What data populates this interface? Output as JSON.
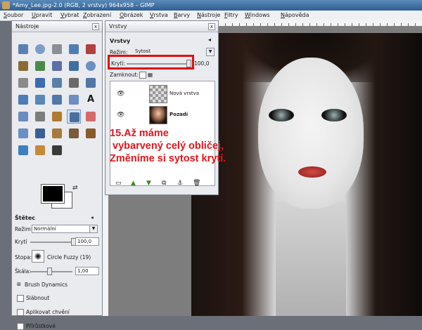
{
  "window": {
    "title": "*Amy_Lee.jpg-2.0 (RGB, 2 vrstvy) 964x958 – GIMP"
  },
  "menu": [
    {
      "label": "Soubor",
      "u": "S",
      "rest": "oubor"
    },
    {
      "label": "Upravit",
      "u": "U",
      "rest": "pravit"
    },
    {
      "label": "Vybrat",
      "u": "V",
      "rest": "ybrat"
    },
    {
      "label": "Zobrazení",
      "u": "Z",
      "rest": "obrazení"
    },
    {
      "label": "Obrázek",
      "u": "O",
      "rest": "brázek"
    },
    {
      "label": "Vrstva",
      "u": "V",
      "rest": "rstva"
    },
    {
      "label": "Barvy",
      "u": "B",
      "rest": "arvy"
    },
    {
      "label": "Nástroje",
      "u": "N",
      "rest": "ástroje"
    },
    {
      "label": "Filtry",
      "u": "F",
      "rest": "iltry"
    },
    {
      "label": "Windows",
      "u": "W",
      "rest": "indows"
    },
    {
      "label": "Nápověda",
      "u": "N",
      "rest": "ápověda"
    }
  ],
  "tools_panel": {
    "title": "Nástroje",
    "close": "x",
    "icons": [
      "rect-select-icon",
      "ellipse-select-icon",
      "free-select-icon",
      "fuzzy-select-icon",
      "color-select-icon",
      "scissors-icon",
      "foreground-select-icon",
      "paths-icon",
      "color-picker-icon",
      "zoom-icon",
      "measure-icon",
      "move-icon",
      "align-icon",
      "crop-icon",
      "rotate-icon",
      "scale-icon",
      "shear-icon",
      "perspective-icon",
      "flip-icon",
      "text-icon",
      "bucket-fill-icon",
      "blend-icon",
      "pencil-icon",
      "paintbrush-icon",
      "eraser-icon",
      "airbrush-icon",
      "ink-icon",
      "clone-icon",
      "heal-icon",
      "perspective-clone-icon",
      "blur-icon",
      "smudge-icon",
      "dodge-burn-icon"
    ]
  },
  "brush": {
    "title": "Štětec",
    "mode_label": "Režim:",
    "mode_value": "Normální",
    "opacity_label": "Krytí",
    "opacity_value": "100,0",
    "brush_label": "Stopa:",
    "brush_value": "Circle Fuzzy (19)",
    "scale_label": "Škála:",
    "scale_value": "1,00",
    "dynamics_label": "Brush Dynamics",
    "options": [
      "Slábnout",
      "Aplikovat chvění",
      "Přírůstkové"
    ]
  },
  "layers_panel": {
    "tab_title": "Vrstvy",
    "section_title": "Vrstvy",
    "close": "x",
    "mode_label": "Režim:",
    "mode_value": "Sytost",
    "opacity_label": "Krytí:",
    "opacity_value": "100,0",
    "lock_label": "Zamknout:",
    "layers": [
      {
        "name": "Nová vrstva",
        "thumb": "transparent"
      },
      {
        "name": "Pozadí",
        "thumb": "portrait"
      }
    ]
  },
  "annotation": {
    "lines": [
      "15.Až máme",
      " vybarvený celý obličej,",
      "Změníme si sytost krytí."
    ],
    "color": "#e3141b"
  },
  "colors": {
    "foreground": "#000000",
    "background": "#ffffff",
    "highlight": "#dd1010"
  }
}
